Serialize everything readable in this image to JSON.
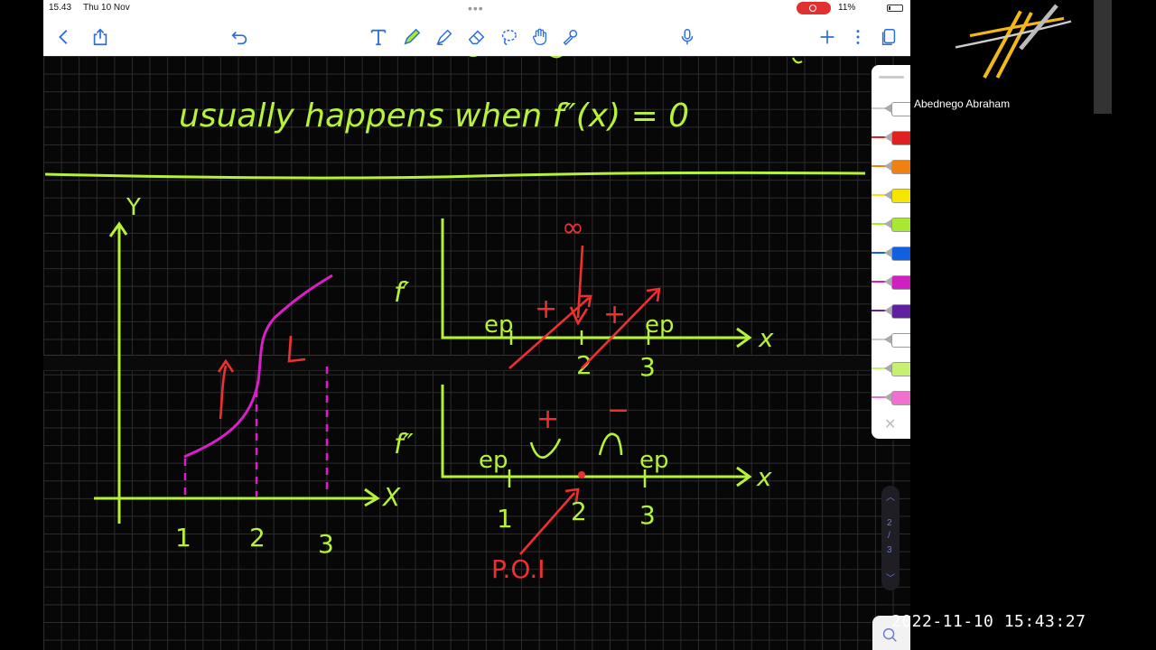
{
  "status_bar": {
    "time": "15.43",
    "date": "Thu 10 Nov",
    "dots": "•••",
    "battery": "11%"
  },
  "toolbar": {
    "icons": [
      "back-icon",
      "share-icon",
      "undo-icon",
      "text-tool-icon",
      "pen-icon",
      "highlighter-icon",
      "eraser-icon",
      "lasso-icon",
      "hand-icon",
      "pointer-icon",
      "microphone-icon",
      "add-icon",
      "more-icon",
      "page-thumbnails-icon"
    ]
  },
  "notes": {
    "line1": "usually happens when f″(x) = 0",
    "graph1": {
      "y_label": "Y",
      "x_label": "X",
      "ticks": [
        "1",
        "2",
        "3"
      ]
    },
    "graph2": {
      "label": "f′",
      "x_label": "x",
      "ticks": [
        "2",
        "3"
      ],
      "ep_left": "ep",
      "ep_right": "ep",
      "plus_left": "+",
      "plus_right": "+",
      "annotation": "∞"
    },
    "graph3": {
      "label": "f″",
      "x_label": "x",
      "ticks": [
        "1",
        "2",
        "3"
      ],
      "ep_left": "ep",
      "ep_right": "ep",
      "plus": "+",
      "minus": "−",
      "poi": "P.O.I"
    }
  },
  "pen_tray": {
    "colors": [
      "#ffffff",
      "#e02020",
      "#f08010",
      "#f5e500",
      "#a8e830",
      "#1060e0",
      "#d020c0",
      "#6020a0",
      "#ffffff",
      "#c8f070",
      "#f070d0"
    ]
  },
  "page_nav": {
    "current": "2",
    "total": "3"
  },
  "webcam": {
    "name": "Abednego Abraham"
  },
  "recording_timestamp": "2022-11-10  15:43:27",
  "colors": {
    "ink_green": "#b6f23a",
    "ink_red": "#f03030",
    "ink_magenta": "#d81fc8",
    "grid": "#2c2c2c"
  }
}
